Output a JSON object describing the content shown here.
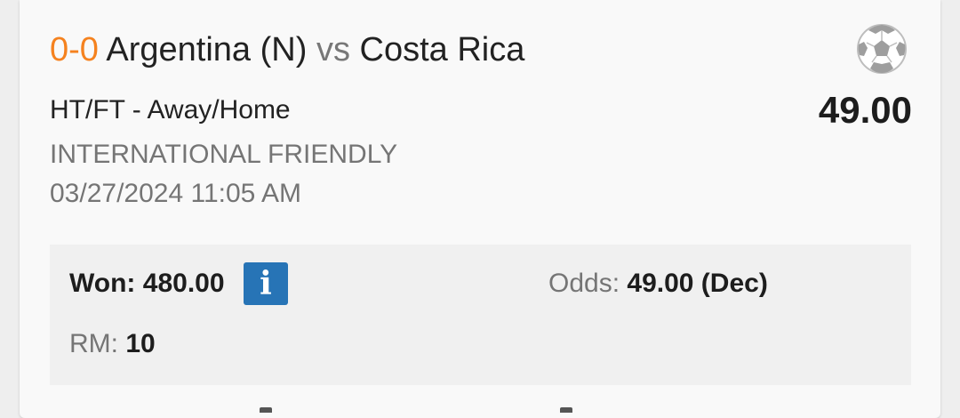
{
  "bet": {
    "score": "0-0",
    "home_team": "Argentina (N)",
    "vs": "vs",
    "away_team": "Costa Rica",
    "sport_icon": "soccer-ball-icon",
    "market": "HT/FT - Away/Home",
    "price": "49.00",
    "league": "INTERNATIONAL FRIENDLY",
    "datetime": "03/27/2024 11:05 AM"
  },
  "details": {
    "won_label": "Won:",
    "won_value": "480.00",
    "info_icon": "info-icon",
    "odds_label": "Odds:",
    "odds_value": "49.00 (Dec)",
    "rm_label": "RM:",
    "rm_value": "10"
  },
  "colors": {
    "score": "#f5821f",
    "info_button": "#2774b6",
    "card": "#f9f9f9",
    "details_bg": "#f0f0f0"
  }
}
